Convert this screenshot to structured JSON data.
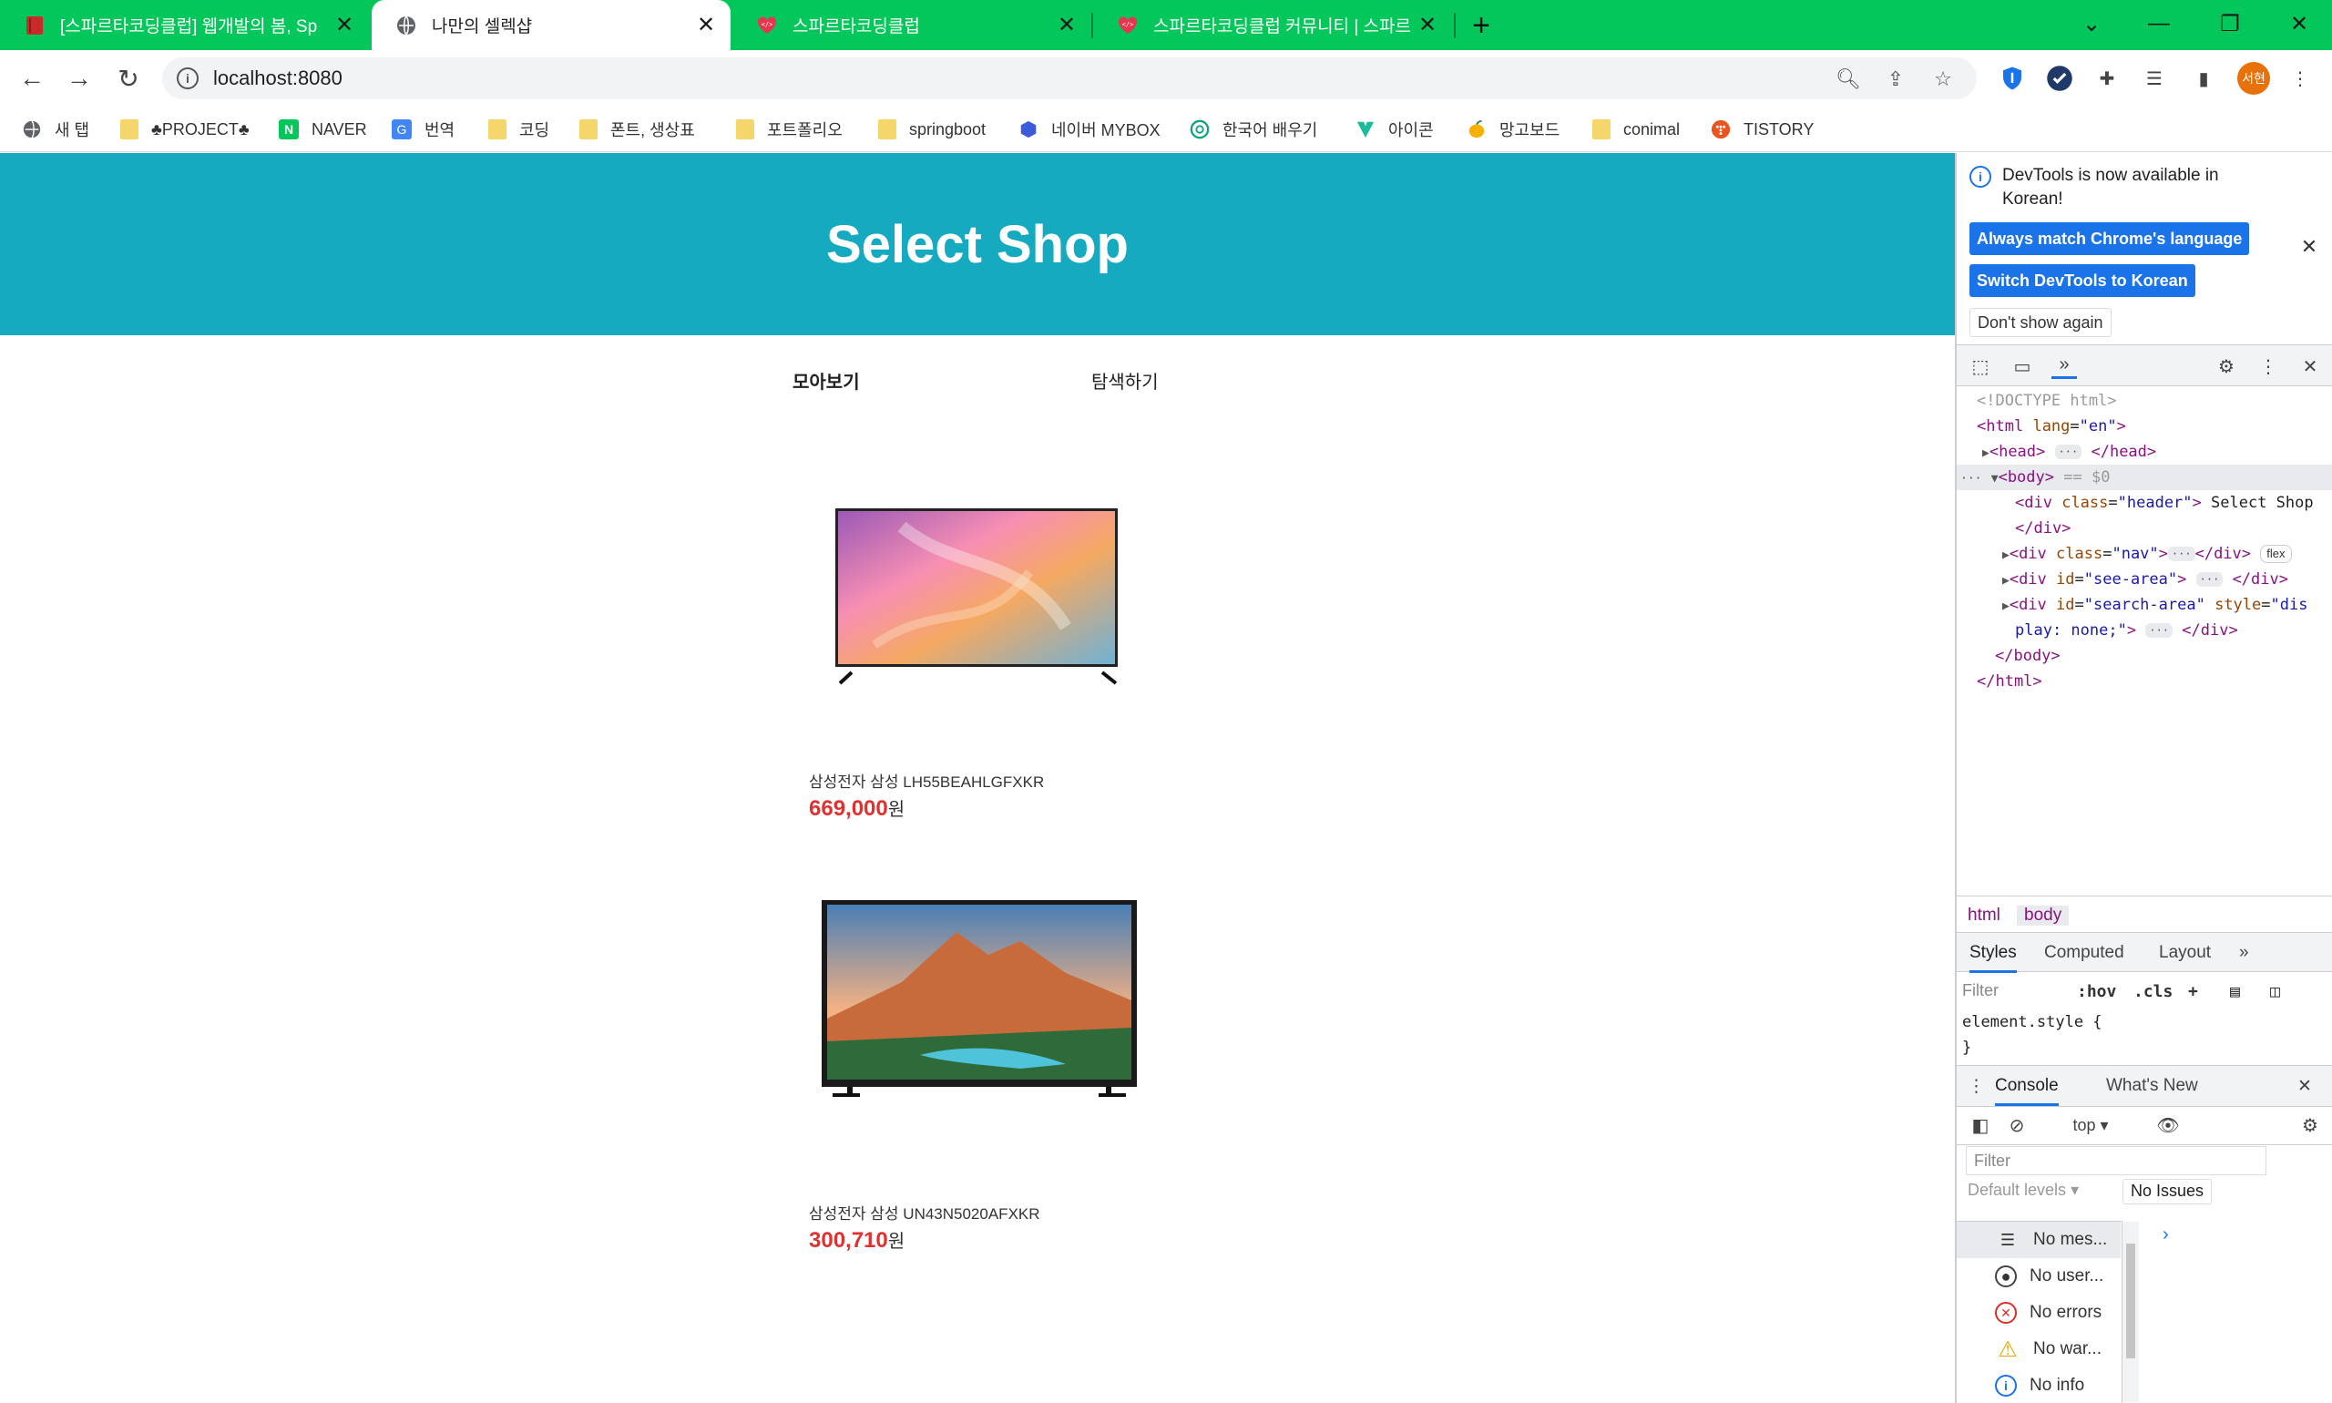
{
  "browser": {
    "tabs": [
      {
        "title": "[스파르타코딩클럽] 웹개발의 봄, Sp",
        "favicon": "book-icon"
      },
      {
        "title": "나만의 셀렉샵",
        "favicon": "globe-icon"
      },
      {
        "title": "스파르타코딩클럽",
        "favicon": "heart-code-icon"
      },
      {
        "title": "스파르타코딩클럽 커뮤니티 | 스파르",
        "favicon": "heart-code-icon"
      }
    ],
    "url": "localhost:8080",
    "profile_initials": "서현",
    "bookmarks": [
      {
        "label": "새 탭"
      },
      {
        "label": "♣PROJECT♣"
      },
      {
        "label": "NAVER"
      },
      {
        "label": "번역"
      },
      {
        "label": "코딩"
      },
      {
        "label": "폰트, 생상표"
      },
      {
        "label": "포트폴리오"
      },
      {
        "label": "springboot"
      },
      {
        "label": "네이버 MYBOX"
      },
      {
        "label": "한국어 배우기"
      },
      {
        "label": "아이콘"
      },
      {
        "label": "망고보드"
      },
      {
        "label": "conimal"
      },
      {
        "label": "TISTORY"
      }
    ]
  },
  "page": {
    "header_title": "Select Shop",
    "nav": {
      "see": "모아보기",
      "search": "탐색하기"
    },
    "products": [
      {
        "title": "삼성전자 삼성 LH55BEAHLGFXKR",
        "price": "669,000",
        "unit": "원"
      },
      {
        "title": "삼성전자 삼성 UN43N5020AFXKR",
        "price": "300,710",
        "unit": "원"
      }
    ]
  },
  "devtools": {
    "banner": {
      "message": "DevTools is now available in Korean!",
      "btn_match": "Always match Chrome's language",
      "btn_switch": "Switch DevTools to Korean",
      "btn_dont_show": "Don't show again"
    },
    "elements": {
      "doctype": "<!DOCTYPE html>",
      "html_open_tag": "html",
      "html_lang_attr": "lang",
      "html_lang_val": "\"en\"",
      "head_tag": "head",
      "body_tag": "body",
      "body_marker": "== $0",
      "div_header_text": "Select Shop",
      "flex_badge": "flex",
      "play_none": "play: none;",
      "dis_text": "dis",
      "html_close": "</html>",
      "body_close": "</body>",
      "div_close": "</div>"
    },
    "crumbs": [
      "html",
      "body"
    ],
    "styles_tabs": [
      "Styles",
      "Computed",
      "Layout"
    ],
    "styles_filter": "Filter",
    "styles_hov": ":hov",
    "styles_cls": ".cls",
    "element_style": "element.style {",
    "element_style_close": "}",
    "drawer_tabs": [
      "Console",
      "What's New"
    ],
    "console_context": "top",
    "console_filter": "Filter",
    "default_levels": "Default levels",
    "no_issues": "No Issues",
    "messages": [
      {
        "label": "No mes...",
        "icon": "list-icon"
      },
      {
        "label": "No user...",
        "icon": "user-icon"
      },
      {
        "label": "No errors",
        "icon": "error-icon"
      },
      {
        "label": "No war...",
        "icon": "warning-icon"
      },
      {
        "label": "No info",
        "icon": "info-icon"
      }
    ],
    "prompt": "›"
  },
  "colors": {
    "tabstrip": "#03c75a",
    "header": "#15aabf",
    "price": "#e03131",
    "devtools_accent": "#1a73e8"
  }
}
